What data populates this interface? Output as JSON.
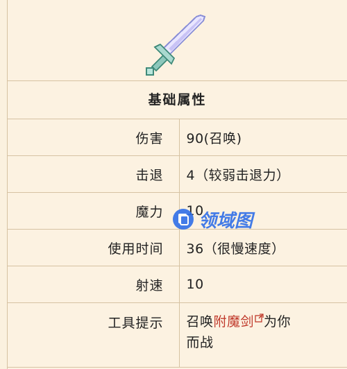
{
  "header": {
    "icon": "enchanted-sword-icon",
    "section_title": "基础属性"
  },
  "rows": [
    {
      "label": "伤害",
      "value": "90(召唤)"
    },
    {
      "label": "击退",
      "value": "4（较弱击退力）"
    },
    {
      "label": "魔力",
      "value": "10"
    },
    {
      "label": "使用时间",
      "value": "36（很慢速度）"
    },
    {
      "label": "射速",
      "value": "10"
    }
  ],
  "tooltip": {
    "label": "工具提示",
    "prefix": "召唤",
    "link": "附魔剑",
    "suffix": "为你",
    "line2": "而战"
  },
  "watermark": {
    "text": "领域图"
  },
  "colors": {
    "link": "#c0392b",
    "border": "#d6c2a2",
    "background": "#fcf2e1",
    "watermark": "#2f6fe8"
  }
}
